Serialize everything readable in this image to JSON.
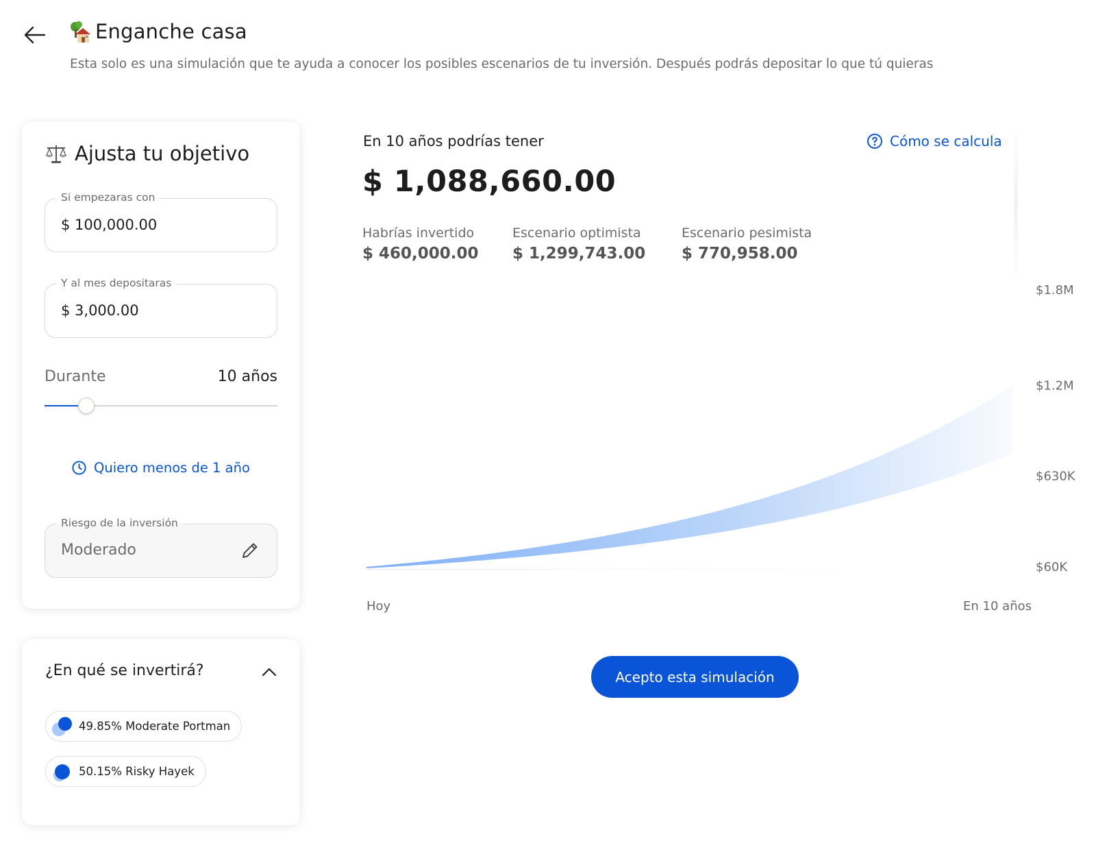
{
  "header": {
    "title": "Enganche casa",
    "subtitle": "Esta solo es una simulación que te ayuda a conocer los posibles escenarios de tu inversión. Después podrás depositar lo que tú quieras",
    "back_icon": "arrow-left-icon",
    "title_icon": "house-with-tree-icon"
  },
  "objetivo": {
    "heading": "Ajusta tu objetivo",
    "heading_icon": "balance-scale-icon",
    "initial": {
      "label": "Si empezaras con",
      "value": "$ 100,000.00"
    },
    "monthly": {
      "label": "Y al mes depositaras",
      "value": "$ 3,000.00"
    },
    "duration": {
      "label": "Durante",
      "value": "10 años",
      "slider_fraction": 0.18
    },
    "short_term_link": "Quiero menos de 1 año",
    "risk": {
      "label": "Riesgo de la inversión",
      "value": "Moderado"
    }
  },
  "invertira": {
    "title": "¿En qué se invertirá?",
    "chips": [
      {
        "label": "49.85% Moderate Portman"
      },
      {
        "label": "50.15% Risky Hayek"
      }
    ]
  },
  "results": {
    "lead": "En 10 años podrías tener",
    "amount": "$ 1,088,660.00",
    "how_link": "Cómo se calcula",
    "stats": [
      {
        "label": "Habrías invertido",
        "value": "$ 460,000.00"
      },
      {
        "label": "Escenario optimista",
        "value": "$ 1,299,743.00"
      },
      {
        "label": "Escenario pesimista",
        "value": "$ 770,958.00"
      }
    ]
  },
  "chart_data": {
    "type": "area",
    "x_labels": [
      "Hoy",
      "En 10 años"
    ],
    "y_ticks": [
      "$1.8M",
      "$1.2M",
      "$630K",
      "$60K"
    ],
    "y_tick_values": [
      1800000,
      1200000,
      630000,
      60000
    ],
    "ylim": [
      60000,
      1800000
    ],
    "series": [
      {
        "values": [
          60000,
          1200000
        ]
      },
      {
        "values": [
          60000,
          770958
        ]
      }
    ],
    "fill_color": "#7fb0f5"
  },
  "actions": {
    "accept": "Acepto esta simulación",
    "accent": "#0a54d8"
  }
}
